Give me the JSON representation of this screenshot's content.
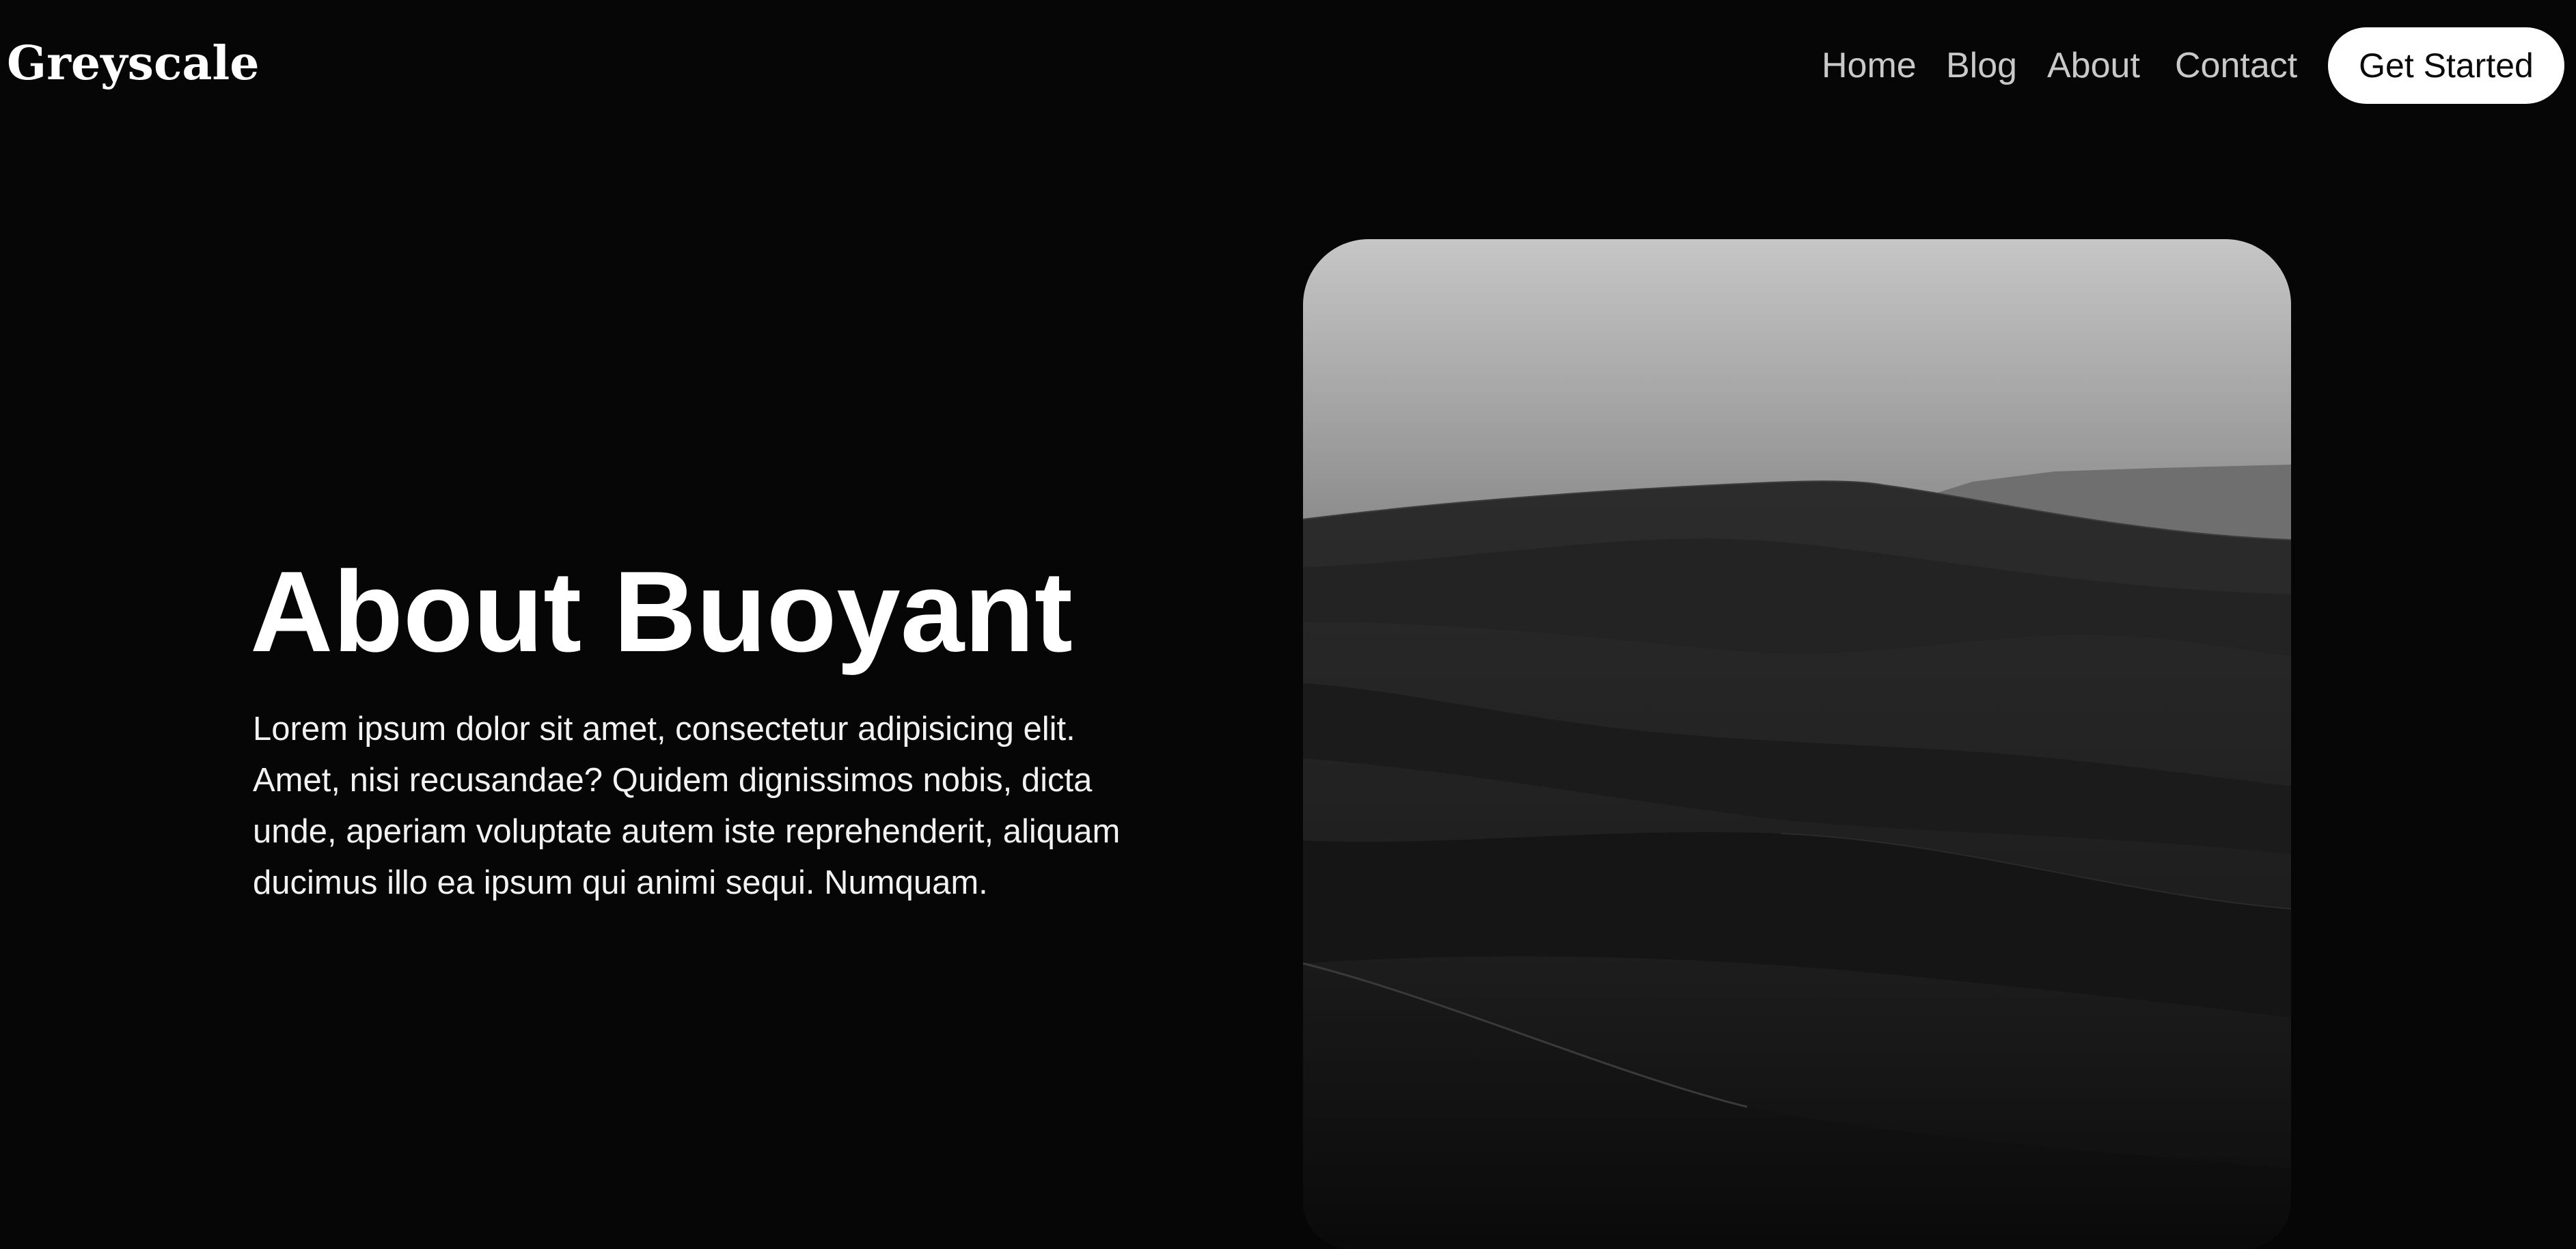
{
  "header": {
    "logo": "Greyscale",
    "nav": {
      "home": "Home",
      "blog": "Blog",
      "about": "About",
      "contact": "Contact"
    },
    "cta_label": "Get Started"
  },
  "hero": {
    "title": "About Buoyant",
    "body": "Lorem ipsum dolor sit amet, consectetur adipisicing elit. Amet, nisi recusandae? Quidem dignissimos nobis, dicta unde, aperiam voluptate autem iste reprehenderit, aliquam ducimus illo ea ipsum qui animi sequi. Numquam.",
    "image_subject": "desert-dunes-greyscale-photo"
  },
  "colors": {
    "background": "#060607",
    "text": "#ffffff",
    "nav_text": "#c9c9c9",
    "cta_background": "#ffffff",
    "cta_text": "#0a0a0a"
  }
}
